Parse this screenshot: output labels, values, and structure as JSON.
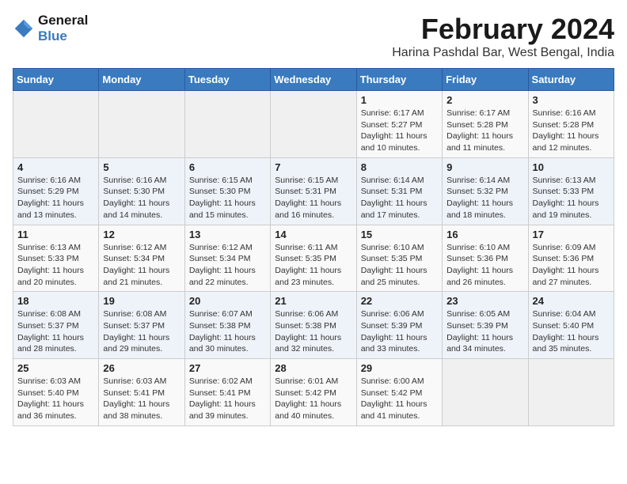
{
  "header": {
    "logo_line1": "General",
    "logo_line2": "Blue",
    "month_title": "February 2024",
    "location": "Harina Pashdal Bar, West Bengal, India"
  },
  "weekdays": [
    "Sunday",
    "Monday",
    "Tuesday",
    "Wednesday",
    "Thursday",
    "Friday",
    "Saturday"
  ],
  "weeks": [
    [
      {
        "day": "",
        "info": ""
      },
      {
        "day": "",
        "info": ""
      },
      {
        "day": "",
        "info": ""
      },
      {
        "day": "",
        "info": ""
      },
      {
        "day": "1",
        "info": "Sunrise: 6:17 AM\nSunset: 5:27 PM\nDaylight: 11 hours and 10 minutes."
      },
      {
        "day": "2",
        "info": "Sunrise: 6:17 AM\nSunset: 5:28 PM\nDaylight: 11 hours and 11 minutes."
      },
      {
        "day": "3",
        "info": "Sunrise: 6:16 AM\nSunset: 5:28 PM\nDaylight: 11 hours and 12 minutes."
      }
    ],
    [
      {
        "day": "4",
        "info": "Sunrise: 6:16 AM\nSunset: 5:29 PM\nDaylight: 11 hours and 13 minutes."
      },
      {
        "day": "5",
        "info": "Sunrise: 6:16 AM\nSunset: 5:30 PM\nDaylight: 11 hours and 14 minutes."
      },
      {
        "day": "6",
        "info": "Sunrise: 6:15 AM\nSunset: 5:30 PM\nDaylight: 11 hours and 15 minutes."
      },
      {
        "day": "7",
        "info": "Sunrise: 6:15 AM\nSunset: 5:31 PM\nDaylight: 11 hours and 16 minutes."
      },
      {
        "day": "8",
        "info": "Sunrise: 6:14 AM\nSunset: 5:31 PM\nDaylight: 11 hours and 17 minutes."
      },
      {
        "day": "9",
        "info": "Sunrise: 6:14 AM\nSunset: 5:32 PM\nDaylight: 11 hours and 18 minutes."
      },
      {
        "day": "10",
        "info": "Sunrise: 6:13 AM\nSunset: 5:33 PM\nDaylight: 11 hours and 19 minutes."
      }
    ],
    [
      {
        "day": "11",
        "info": "Sunrise: 6:13 AM\nSunset: 5:33 PM\nDaylight: 11 hours and 20 minutes."
      },
      {
        "day": "12",
        "info": "Sunrise: 6:12 AM\nSunset: 5:34 PM\nDaylight: 11 hours and 21 minutes."
      },
      {
        "day": "13",
        "info": "Sunrise: 6:12 AM\nSunset: 5:34 PM\nDaylight: 11 hours and 22 minutes."
      },
      {
        "day": "14",
        "info": "Sunrise: 6:11 AM\nSunset: 5:35 PM\nDaylight: 11 hours and 23 minutes."
      },
      {
        "day": "15",
        "info": "Sunrise: 6:10 AM\nSunset: 5:35 PM\nDaylight: 11 hours and 25 minutes."
      },
      {
        "day": "16",
        "info": "Sunrise: 6:10 AM\nSunset: 5:36 PM\nDaylight: 11 hours and 26 minutes."
      },
      {
        "day": "17",
        "info": "Sunrise: 6:09 AM\nSunset: 5:36 PM\nDaylight: 11 hours and 27 minutes."
      }
    ],
    [
      {
        "day": "18",
        "info": "Sunrise: 6:08 AM\nSunset: 5:37 PM\nDaylight: 11 hours and 28 minutes."
      },
      {
        "day": "19",
        "info": "Sunrise: 6:08 AM\nSunset: 5:37 PM\nDaylight: 11 hours and 29 minutes."
      },
      {
        "day": "20",
        "info": "Sunrise: 6:07 AM\nSunset: 5:38 PM\nDaylight: 11 hours and 30 minutes."
      },
      {
        "day": "21",
        "info": "Sunrise: 6:06 AM\nSunset: 5:38 PM\nDaylight: 11 hours and 32 minutes."
      },
      {
        "day": "22",
        "info": "Sunrise: 6:06 AM\nSunset: 5:39 PM\nDaylight: 11 hours and 33 minutes."
      },
      {
        "day": "23",
        "info": "Sunrise: 6:05 AM\nSunset: 5:39 PM\nDaylight: 11 hours and 34 minutes."
      },
      {
        "day": "24",
        "info": "Sunrise: 6:04 AM\nSunset: 5:40 PM\nDaylight: 11 hours and 35 minutes."
      }
    ],
    [
      {
        "day": "25",
        "info": "Sunrise: 6:03 AM\nSunset: 5:40 PM\nDaylight: 11 hours and 36 minutes."
      },
      {
        "day": "26",
        "info": "Sunrise: 6:03 AM\nSunset: 5:41 PM\nDaylight: 11 hours and 38 minutes."
      },
      {
        "day": "27",
        "info": "Sunrise: 6:02 AM\nSunset: 5:41 PM\nDaylight: 11 hours and 39 minutes."
      },
      {
        "day": "28",
        "info": "Sunrise: 6:01 AM\nSunset: 5:42 PM\nDaylight: 11 hours and 40 minutes."
      },
      {
        "day": "29",
        "info": "Sunrise: 6:00 AM\nSunset: 5:42 PM\nDaylight: 11 hours and 41 minutes."
      },
      {
        "day": "",
        "info": ""
      },
      {
        "day": "",
        "info": ""
      }
    ]
  ]
}
